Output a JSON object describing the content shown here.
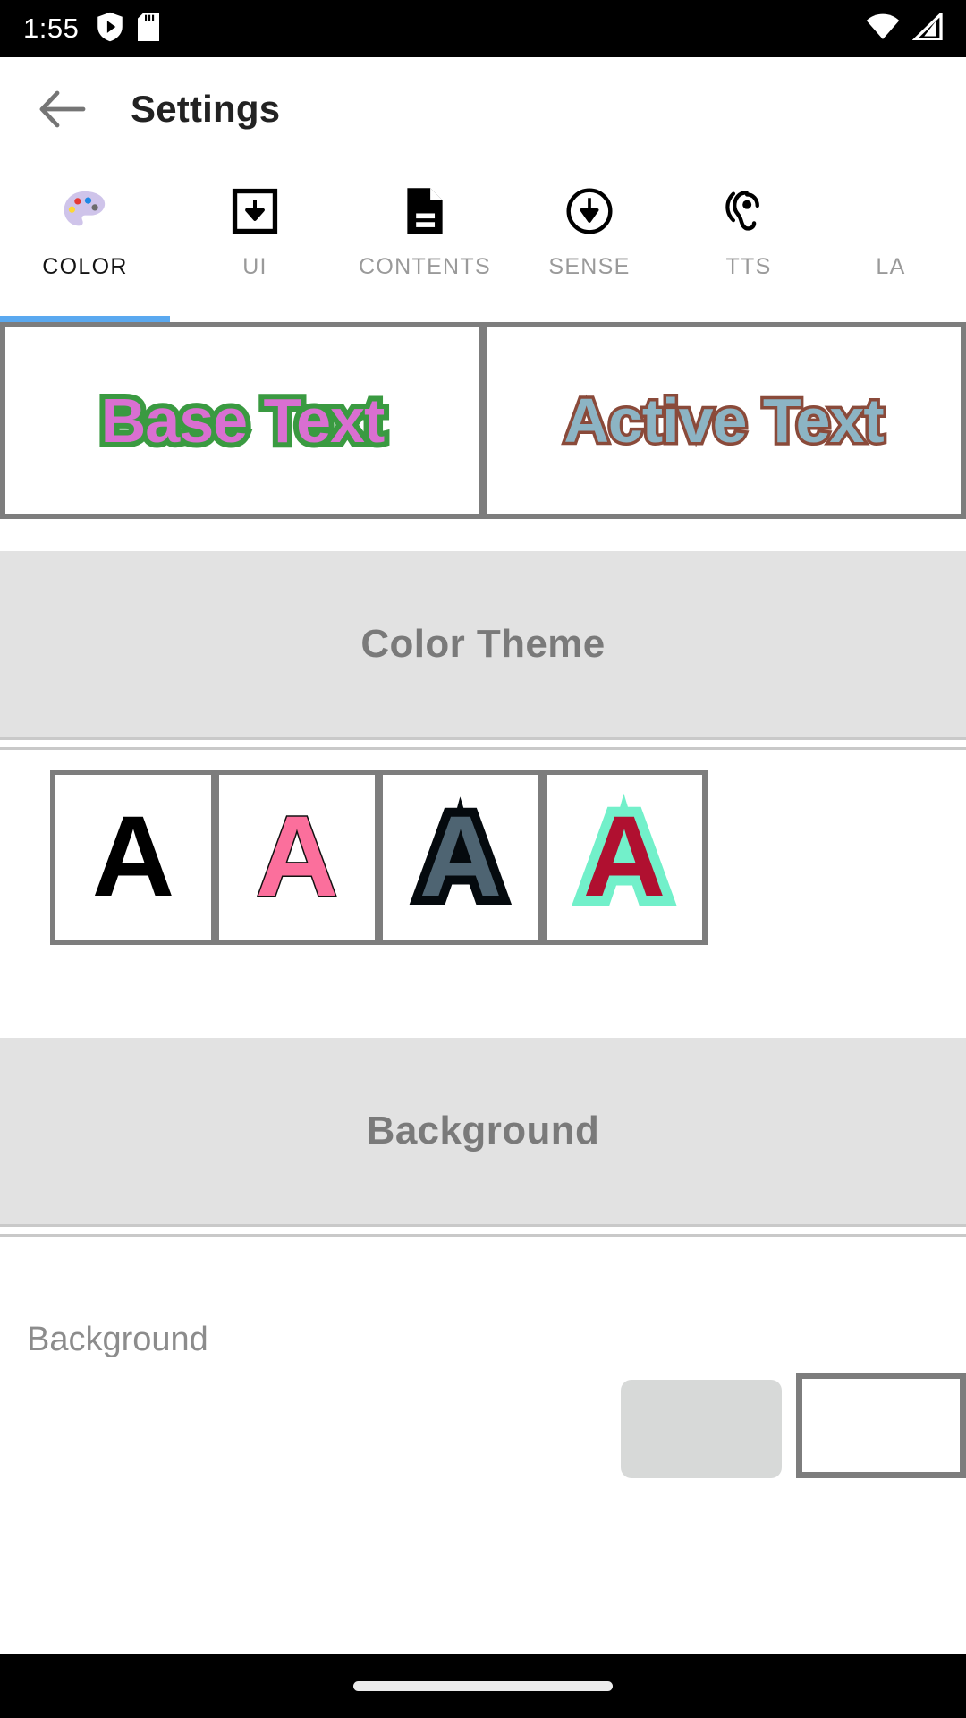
{
  "status_bar": {
    "time": "1:55",
    "left_icons": [
      "play-protect-icon",
      "sd-card-icon"
    ],
    "right_icons": [
      "wifi-icon",
      "cellular-signal-icon"
    ]
  },
  "app_bar": {
    "back_icon": "back-arrow-icon",
    "title": "Settings"
  },
  "tabs": {
    "active_index": 0,
    "items": [
      {
        "label": "COLOR",
        "icon": "palette-icon"
      },
      {
        "label": "UI",
        "icon": "download-box-icon"
      },
      {
        "label": "CONTENTS",
        "icon": "document-icon"
      },
      {
        "label": "SENSE",
        "icon": "circle-arrow-down-icon"
      },
      {
        "label": "TTS",
        "icon": "ear-hearing-icon"
      },
      {
        "label": "LA",
        "icon": "cut-off-icon"
      }
    ],
    "indicator_color": "#5aa9f0"
  },
  "preview": {
    "base": {
      "text": "Base Text",
      "fill_color": "#d96fd1",
      "outline_color": "#3a9a41"
    },
    "active": {
      "text": "Active Text",
      "fill_color": "#8cb4c4",
      "outline_color": "#8a4a3a"
    }
  },
  "color_theme_section": {
    "header": "Color Theme",
    "swatches": [
      {
        "letter": "A",
        "fill_color": "#000000",
        "outline_color": "#000000"
      },
      {
        "letter": "A",
        "fill_color": "#fb6f9c",
        "outline_color": "#111111"
      },
      {
        "letter": "A",
        "fill_color": "#4e6472",
        "outline_color": "#050a0e"
      },
      {
        "letter": "A",
        "fill_color": "#b01030",
        "outline_color": "#72f0ca"
      }
    ]
  },
  "background_section": {
    "header": "Background",
    "row_label": "Background",
    "button_color": "#d7d9d8",
    "swatch_color": "#ffffff"
  },
  "nav_bar": {
    "home_indicator": "home-indicator-pill"
  }
}
